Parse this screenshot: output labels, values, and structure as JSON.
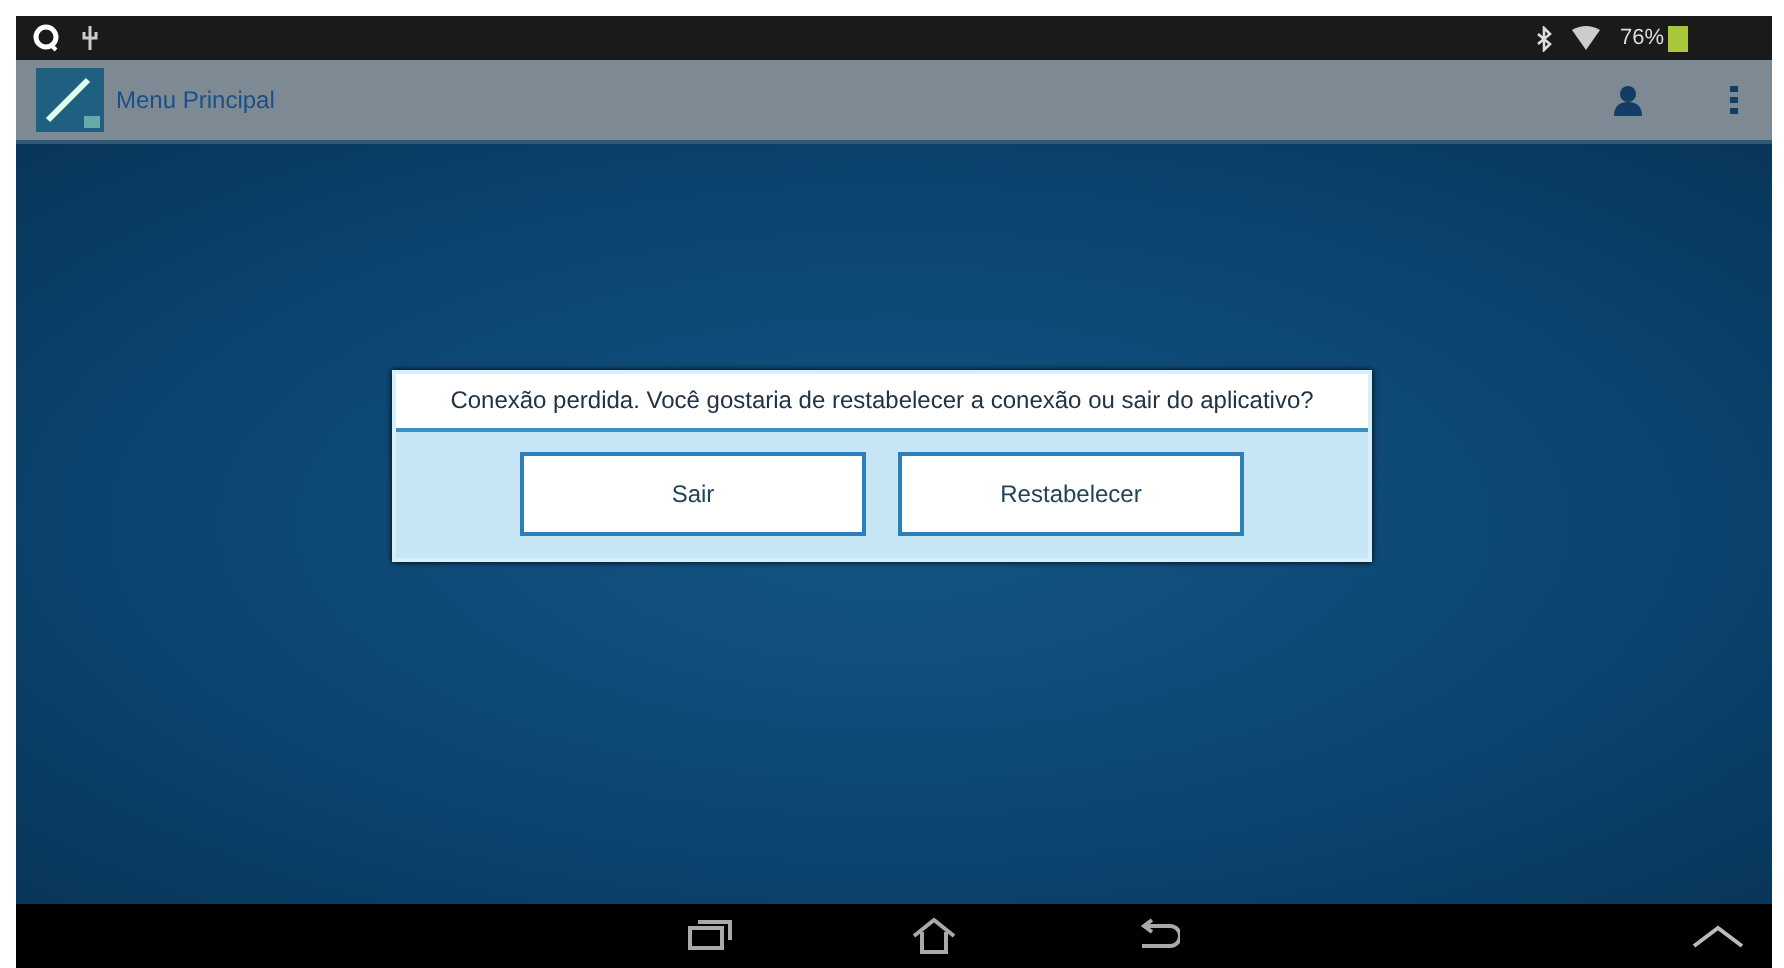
{
  "status_bar": {
    "battery": "76%"
  },
  "app_bar": {
    "title": "Menu Principal"
  },
  "dialog": {
    "message": "Conexão perdida. Você gostaria de restabelecer a conexão ou sair do aplicativo?",
    "buttons": [
      "Sair",
      "Restabelecer"
    ]
  }
}
